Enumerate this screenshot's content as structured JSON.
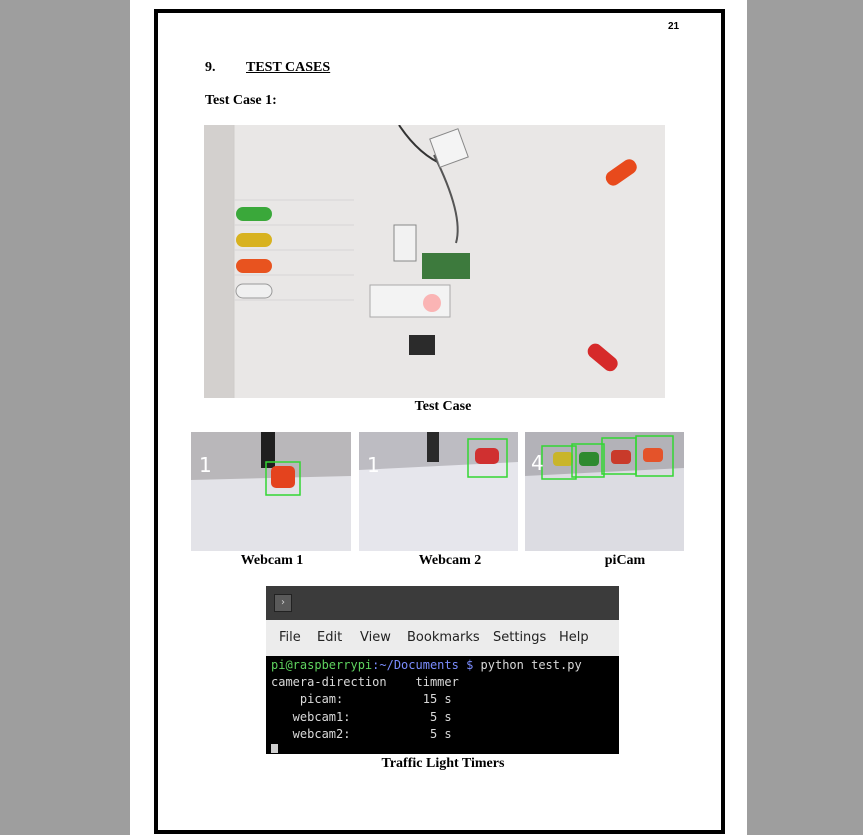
{
  "page": {
    "page_number": "21",
    "section_number": "9.",
    "section_title": "TEST CASES",
    "subheading": "Test Case 1:"
  },
  "figures": {
    "test_case_caption": "Test Case",
    "webcam1_caption": "Webcam 1",
    "webcam2_caption": "Webcam 2",
    "picam_caption": "piCam",
    "timers_caption": "Traffic Light Timers",
    "webcam1_count": "1",
    "webcam2_count": "1",
    "picam_count": "4"
  },
  "terminal": {
    "menu": [
      "File",
      "Edit",
      "View",
      "Bookmarks",
      "Settings",
      "Help"
    ],
    "prompt_user": "pi@raspberrypi",
    "prompt_path": ":~/Documents $",
    "command": " python test.py",
    "header_line": "camera-direction    timmer",
    "rows": [
      "    picam:           15 s",
      "   webcam1:           5 s",
      "   webcam2:           5 s"
    ],
    "colors": {
      "user": "#5fd35f",
      "path": "#7b8dff",
      "text": "#d9d9d9"
    }
  }
}
